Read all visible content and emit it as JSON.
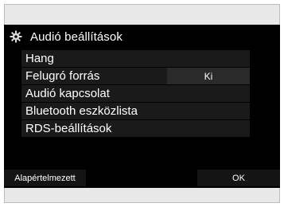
{
  "header": {
    "title": "Audió beállítások",
    "icon": "gear-icon"
  },
  "menu": {
    "items": [
      {
        "label": "Hang",
        "value": ""
      },
      {
        "label": "Felugró forrás",
        "value": "Ki"
      },
      {
        "label": "Audió kapcsolat",
        "value": ""
      },
      {
        "label": "Bluetooth eszközlista",
        "value": ""
      },
      {
        "label": "RDS-beállítások",
        "value": ""
      }
    ]
  },
  "footer": {
    "default_label": "Alapértelmezett",
    "ok_label": "OK"
  },
  "colors": {
    "screen_background": "#000000",
    "text": "#ffffff",
    "frame": "#e8e8e8"
  }
}
